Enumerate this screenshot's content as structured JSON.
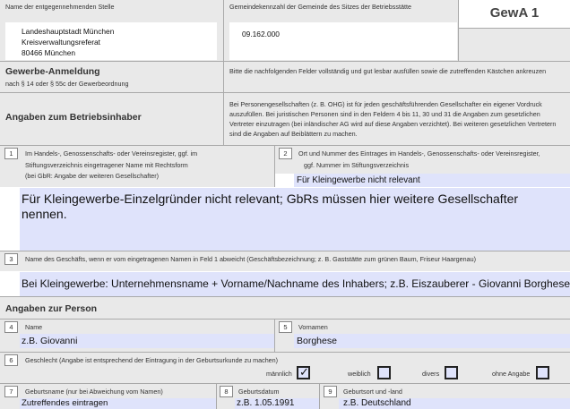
{
  "header": {
    "recipient_label": "Name der entgegennehmenden Stelle",
    "recipient_lines": [
      "Landeshauptstadt München",
      "Kreisverwaltungsreferat",
      "80466 München"
    ],
    "municipality_label": "Gemeindekennzahl der Gemeinde des Sitzes der Betriebsstätte",
    "municipality_code": "09.162.000",
    "form_code": "GewA 1"
  },
  "intro": {
    "title": "Gewerbe-Anmeldung",
    "subtitle": "nach § 14 oder § 55c der Gewerbeordnung",
    "instruction": "Bitte die nachfolgenden Felder vollständig und gut lesbar ausfüllen sowie die zutreffenden Kästchen ankreuzen"
  },
  "owner_section": {
    "title": "Angaben zum Betriebsinhaber",
    "note": "Bei Personengesellschaften (z. B. OHG) ist für jeden geschäftsführenden Gesellschafter ein eigener Vordruck auszufüllen. Bei juristischen Personen sind in den Feldern 4 bis 11, 30 und 31 die Angaben zum gesetzlichen Vertreter einzutragen (bei inländischer AG wird auf diese Angaben verzichtet). Bei weiteren gesetzlichen Vertretern sind die Angaben auf Beiblättern zu machen."
  },
  "field1": {
    "number": "1",
    "label_lines": [
      "Im Handels-, Genossenschafts- oder Vereinsregister, ggf. im",
      "Stiftungsverzeichnis eingetragener Name mit Rechtsform",
      "(bei GbR: Angabe der weiteren Gesellschafter)"
    ],
    "value_lines": [
      "Für Kleingewerbe-Einzelgründer nicht relevant; GbRs müssen hier weitere Gesellschafter",
      "nennen."
    ]
  },
  "field2": {
    "number": "2",
    "label_lines": [
      "Ort und Nummer des Eintrages im Handels-, Genossenschafts- oder Vereinsregister,",
      "ggf. Nummer im Stiftungsverzeichnis"
    ],
    "value": "Für Kleingewerbe nicht relevant"
  },
  "field3": {
    "number": "3",
    "label": "Name des Geschäfts, wenn er vom eingetragenen Namen in Feld 1 abweicht (Geschäftsbezeichnung; z. B. Gaststätte zum grünen Baum, Friseur Haargenau)",
    "value": "Bei Kleingewerbe: Unternehmensname + Vorname/Nachname des Inhabers; z.B. Eiszauberer - Giovanni Borghese"
  },
  "person_section": {
    "title": "Angaben zur Person"
  },
  "field4": {
    "number": "4",
    "label": "Name",
    "value": "z.B. Giovanni"
  },
  "field5": {
    "number": "5",
    "label": "Vornamen",
    "value": "Borghese"
  },
  "field6": {
    "number": "6",
    "label": "Geschlecht (Angabe ist entsprechend der Eintragung in der Geburtsurkunde zu machen)",
    "options": [
      {
        "label": "männlich",
        "checked": true,
        "mark": "✓"
      },
      {
        "label": "weiblich",
        "checked": false
      },
      {
        "label": "divers",
        "checked": false
      },
      {
        "label": "ohne Angabe",
        "checked": false
      }
    ]
  },
  "field7": {
    "number": "7",
    "label": "Geburtsname (nur bei Abweichung vom Namen)",
    "value": "Zutreffendes eintragen"
  },
  "field8": {
    "number": "8",
    "label": "Geburtsdatum",
    "value": "z.B. 1.05.1991"
  },
  "field9": {
    "number": "9",
    "label": "Geburtsort und -land",
    "value": "z.B. Deutschland"
  }
}
